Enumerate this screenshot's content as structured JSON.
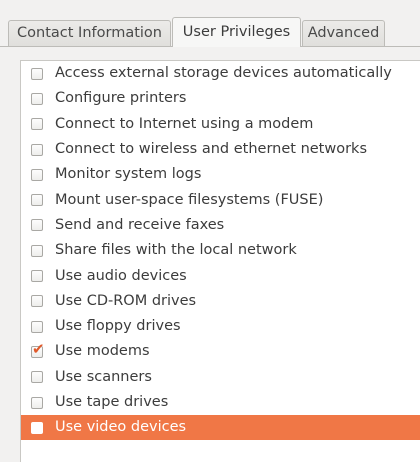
{
  "tabs": [
    {
      "label": "Contact Information",
      "active": false
    },
    {
      "label": "User Privileges",
      "active": true
    },
    {
      "label": "Advanced",
      "active": false
    }
  ],
  "privileges": [
    {
      "label": "Access external storage devices automatically",
      "checked": false,
      "selected": false
    },
    {
      "label": "Configure printers",
      "checked": false,
      "selected": false
    },
    {
      "label": "Connect to Internet using a modem",
      "checked": false,
      "selected": false
    },
    {
      "label": "Connect to wireless and ethernet networks",
      "checked": false,
      "selected": false
    },
    {
      "label": "Monitor system logs",
      "checked": false,
      "selected": false
    },
    {
      "label": "Mount user-space filesystems (FUSE)",
      "checked": false,
      "selected": false
    },
    {
      "label": "Send and receive faxes",
      "checked": false,
      "selected": false
    },
    {
      "label": "Share files with the local network",
      "checked": false,
      "selected": false
    },
    {
      "label": "Use audio devices",
      "checked": false,
      "selected": false
    },
    {
      "label": "Use CD-ROM drives",
      "checked": false,
      "selected": false
    },
    {
      "label": "Use floppy drives",
      "checked": false,
      "selected": false
    },
    {
      "label": "Use modems",
      "checked": true,
      "selected": false
    },
    {
      "label": "Use scanners",
      "checked": false,
      "selected": false
    },
    {
      "label": "Use tape drives",
      "checked": false,
      "selected": false
    },
    {
      "label": "Use video devices",
      "checked": false,
      "selected": true
    }
  ],
  "icons": {
    "checkmark": "✔"
  },
  "colors": {
    "selection": "#f07746",
    "checkmark": "#e05a2b"
  }
}
